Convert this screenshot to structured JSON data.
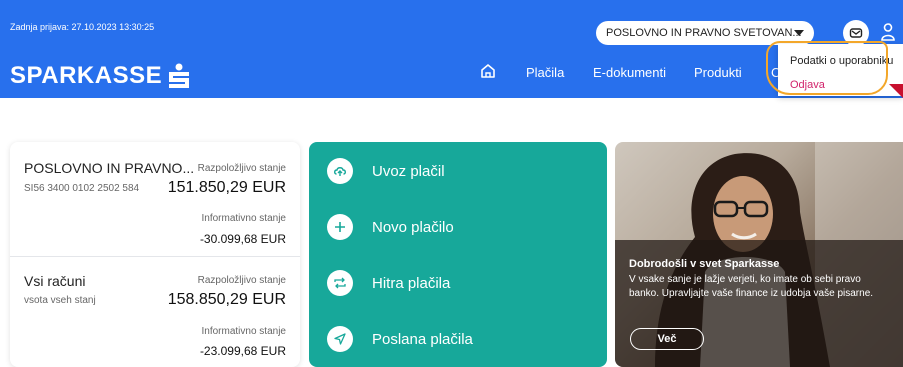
{
  "header": {
    "last_login": "Zadnja prijava: 27.10.2023 13:30:25",
    "brand": "SPARKASSE",
    "account_select": "POSLOVNO IN PRAVNO SVETOVAN...",
    "nav": [
      "Plačila",
      "E-dokumenti",
      "Produkti"
    ],
    "nav_partial": "C",
    "colors": {
      "header_bg": "#2870ed",
      "teal": "#17a89a",
      "logout": "#d1236b",
      "highlight": "#f3a72a"
    }
  },
  "user_menu": {
    "items": [
      "Podatki o uporabniku",
      "Odjava"
    ]
  },
  "accounts": [
    {
      "name": "POSLOVNO IN PRAVNO...",
      "iban": "SI56 3400 0102 2502 584",
      "available_label": "Razpoložljivo stanje",
      "available": "151.850,29 EUR",
      "info_label": "Informativno stanje",
      "info": "-30.099,68 EUR"
    },
    {
      "name": "Vsi računi",
      "iban": "vsota vseh stanj",
      "available_label": "Razpoložljivo stanje",
      "available": "158.850,29 EUR",
      "info_label": "Informativno stanje",
      "info": "-23.099,68 EUR"
    }
  ],
  "actions": [
    {
      "label": "Uvoz plačil",
      "icon": "upload-icon"
    },
    {
      "label": "Novo plačilo",
      "icon": "plus-icon"
    },
    {
      "label": "Hitra plačila",
      "icon": "repeat-icon"
    },
    {
      "label": "Poslana plačila",
      "icon": "send-icon"
    }
  ],
  "promo": {
    "title": "Dobrodošli v svet Sparkasse",
    "body": "V vsake sanje je lažje verjeti, ko imate ob sebi pravo banko. Upravljajte vaše finance iz udobja vaše pisarne.",
    "button": "Več"
  }
}
